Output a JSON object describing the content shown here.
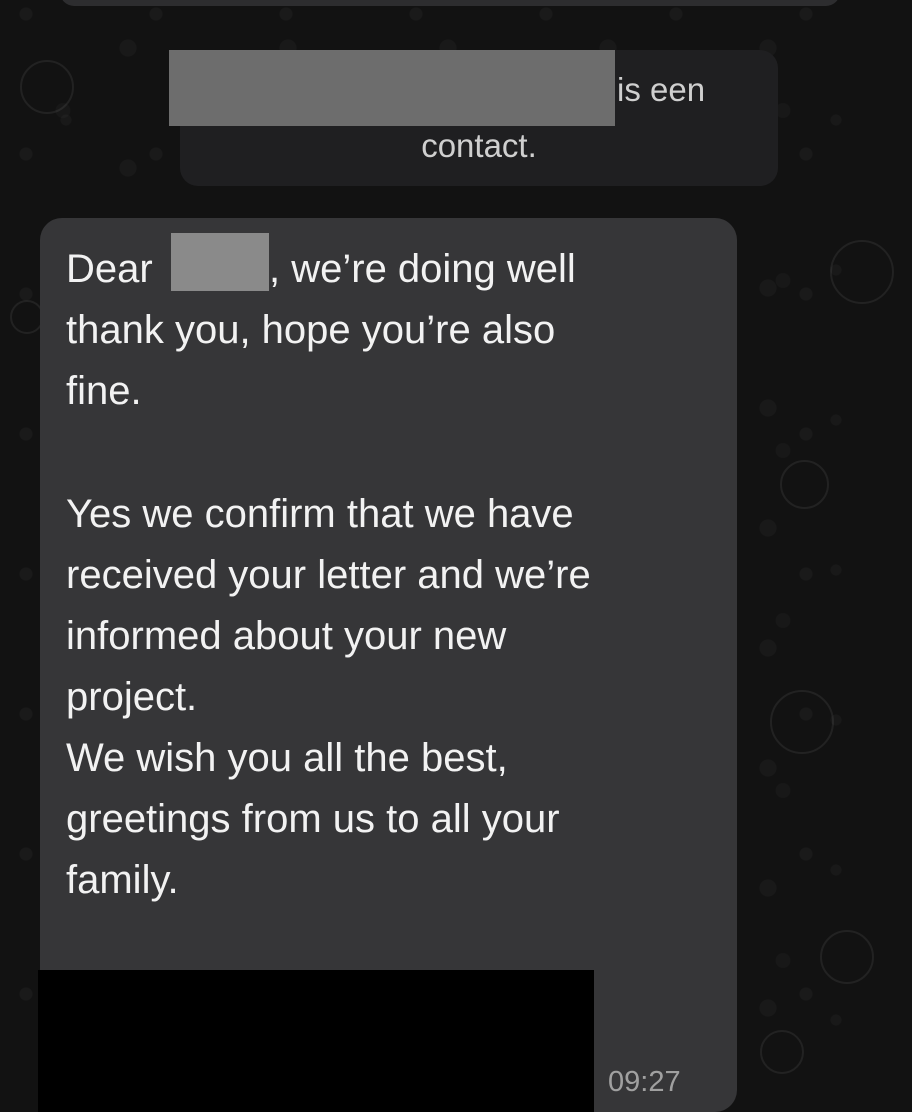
{
  "system_notice": {
    "text_after_redaction": "is een",
    "text_line2": "contact."
  },
  "message": {
    "lines": [
      "Dear",
      ", we’re doing well",
      "thank you, hope you’re also",
      "fine.",
      "Yes we confirm that we have",
      "received your letter and we’re",
      "informed about your new",
      "project.",
      "We wish you all the best,",
      "greetings from us to all your",
      "family."
    ],
    "time": "09:27"
  },
  "colors": {
    "background": "#121212",
    "bubble": "#363638",
    "notice": "#1f1f21",
    "text": "#f2f2f2",
    "timestamp": "#a0a0a0"
  }
}
